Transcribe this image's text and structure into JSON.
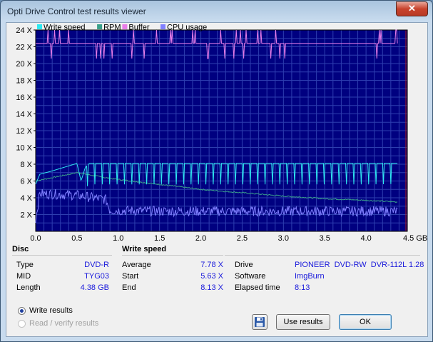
{
  "window": {
    "title": "Opti Drive Control test results viewer",
    "close_glyph": "✕"
  },
  "chart_data": {
    "type": "line",
    "legend": [
      {
        "name": "Write speed",
        "color": "#2ee8f0"
      },
      {
        "name": "RPM",
        "color": "#3aa08a"
      },
      {
        "name": "Buffer",
        "color": "#e87de8"
      },
      {
        "name": "CPU usage",
        "color": "#8080ff"
      }
    ],
    "background": "#000080",
    "x_ticks": [
      "0.0",
      "0.5",
      "1.0",
      "1.5",
      "2.0",
      "2.5",
      "3.0",
      "3.5",
      "4.0",
      "4.5 GB"
    ],
    "y_ticks": [
      "2 X",
      "4 X",
      "6 X",
      "8 X",
      "10 X",
      "12 X",
      "14 X",
      "16 X",
      "18 X",
      "20 X",
      "22 X",
      "24 X"
    ],
    "xlim": [
      0,
      4.5
    ],
    "ylim": [
      0,
      24
    ],
    "grid": true,
    "series": [
      {
        "name": "Write speed",
        "x": [
          0.0,
          0.05,
          0.2,
          0.5,
          0.55,
          0.6,
          0.65,
          0.7,
          0.8,
          1.0,
          1.5,
          2.0,
          2.5,
          3.0,
          3.5,
          4.0,
          4.38
        ],
        "values": [
          5.63,
          6.8,
          7.2,
          8.1,
          6.0,
          7.6,
          8.1,
          8.1,
          8.1,
          8.1,
          8.1,
          8.1,
          8.1,
          8.1,
          8.1,
          8.1,
          8.13
        ]
      },
      {
        "name": "RPM",
        "x": [
          0.0,
          0.5,
          0.9,
          1.5,
          2.0,
          2.5,
          3.0,
          3.5,
          4.0,
          4.38
        ],
        "values": [
          6.0,
          7.0,
          6.3,
          5.6,
          5.0,
          4.6,
          4.2,
          3.9,
          3.7,
          3.5
        ]
      },
      {
        "name": "Buffer",
        "x": [
          0.0,
          4.38
        ],
        "values": [
          22.4,
          22.4
        ]
      },
      {
        "name": "CPU usage",
        "x": [
          0.0,
          0.05,
          0.3,
          0.5,
          0.7,
          0.85,
          0.9,
          1.5,
          2.0,
          3.0,
          4.0,
          4.38
        ],
        "values": [
          1.5,
          4.5,
          4.4,
          4.3,
          4.0,
          3.8,
          2.5,
          2.4,
          2.4,
          2.4,
          2.4,
          2.4
        ]
      }
    ]
  },
  "disc": {
    "heading": "Disc",
    "rows": [
      {
        "label": "Type",
        "value": "DVD-R"
      },
      {
        "label": "MID",
        "value": "TYG03"
      },
      {
        "label": "Length",
        "value": "4.38 GB"
      }
    ]
  },
  "write_speed": {
    "heading": "Write speed",
    "rows": [
      {
        "label": "Average",
        "value": "7.78 X"
      },
      {
        "label": "Start",
        "value": "5.63 X"
      },
      {
        "label": "End",
        "value": "8.13 X"
      }
    ]
  },
  "drive": {
    "rows": [
      {
        "label": "Drive",
        "value": "PIONEER  DVD-RW  DVR-112L 1.28"
      },
      {
        "label": "Software",
        "value": "ImgBurn"
      },
      {
        "label": "Elapsed time",
        "value": "8:13"
      }
    ]
  },
  "options": {
    "write_results": "Write results",
    "read_verify_results": "Read / verify results"
  },
  "buttons": {
    "use_results": "Use results",
    "ok": "OK",
    "save_icon": "floppy-disk"
  }
}
